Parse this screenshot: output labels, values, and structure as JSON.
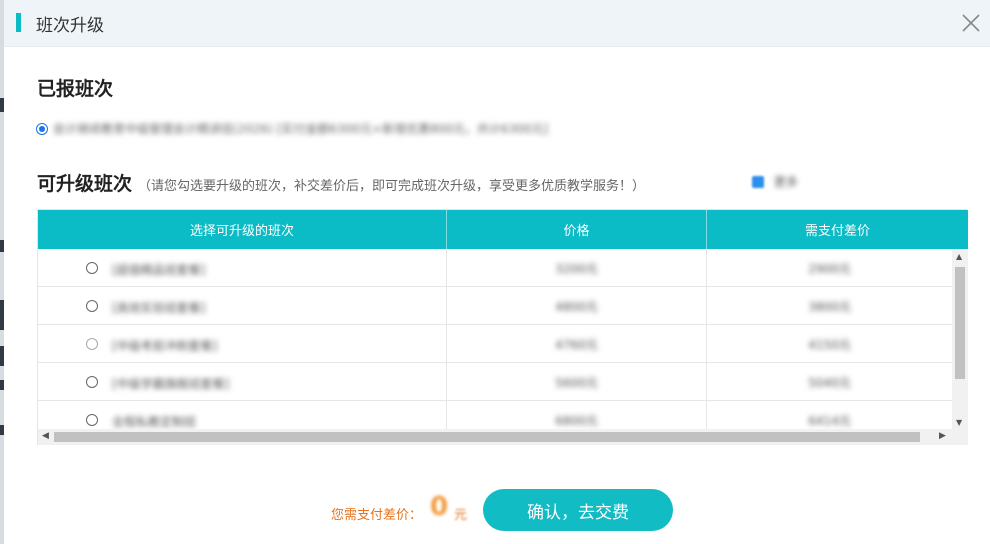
{
  "dialog": {
    "title": "班次升级"
  },
  "registered": {
    "heading": "已报班次",
    "item_text": "会计继续教育中级管理会计精讲班(2026) [实付金额6300元+新增优惠800元，共计6300元]"
  },
  "upgradable": {
    "heading": "可升级班次",
    "hint": "（请您勾选要升级的班次，补交差价后，即可完成班次升级，享受更多优质教学服务！）",
    "side_option": "更多"
  },
  "table": {
    "headers": [
      "选择可升级的班次",
      "价格",
      "需支付差价"
    ],
    "rows": [
      {
        "name": "[超值精品班套餐]",
        "price": "3200元",
        "diff": "2900元"
      },
      {
        "name": "[高效实验班套餐]",
        "price": "4800元",
        "diff": "3800元"
      },
      {
        "name": "[中级考前冲刺套餐]",
        "price": "4760元",
        "diff": "4150元"
      },
      {
        "name": "[中级学霸旗舰班套餐]",
        "price": "5600元",
        "diff": "5040元"
      },
      {
        "name": "全程私教定制班",
        "price": "6800元",
        "diff": "6414元"
      }
    ]
  },
  "footer": {
    "label": "您需支付差价：",
    "amount": "0",
    "unit": "元",
    "confirm_label": "确认，去交费"
  }
}
